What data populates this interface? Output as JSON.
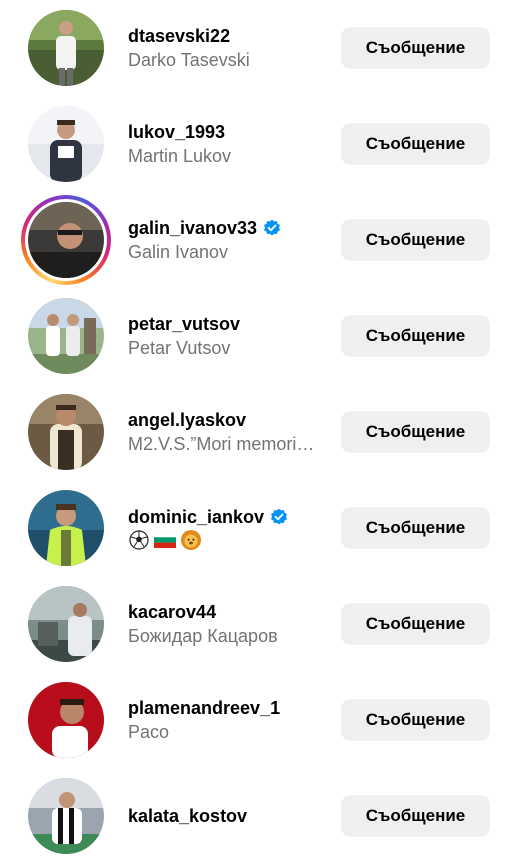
{
  "message_label": "Съобщение",
  "users": [
    {
      "username": "dtasevski22",
      "subtitle": "Darko Tasevski",
      "verified": false,
      "story": false
    },
    {
      "username": "lukov_1993",
      "subtitle": "Martin Lukov",
      "verified": false,
      "story": false
    },
    {
      "username": "galin_ivanov33",
      "subtitle": "Galin Ivanov",
      "verified": true,
      "story": true
    },
    {
      "username": "petar_vutsov",
      "subtitle": "Petar Vutsov",
      "verified": false,
      "story": false
    },
    {
      "username": "angel.lyaskov",
      "subtitle": "M2.V.S.”Mori memori…",
      "verified": false,
      "story": false
    },
    {
      "username": "dominic_iankov",
      "subtitle": "",
      "subtitle_emojis": [
        "soccer-ball",
        "bulgaria-flag",
        "lion-face"
      ],
      "verified": true,
      "story": false
    },
    {
      "username": "kacarov44",
      "subtitle": "Божидар Кацаров",
      "verified": false,
      "story": false
    },
    {
      "username": "plamenandreev_1",
      "subtitle": "Paco",
      "verified": false,
      "story": false
    },
    {
      "username": "kalata_kostov",
      "subtitle": "",
      "verified": false,
      "story": false
    }
  ],
  "colors": {
    "verified_blue": "#0095f6",
    "button_bg": "#efefef",
    "subtitle_gray": "#737373"
  }
}
